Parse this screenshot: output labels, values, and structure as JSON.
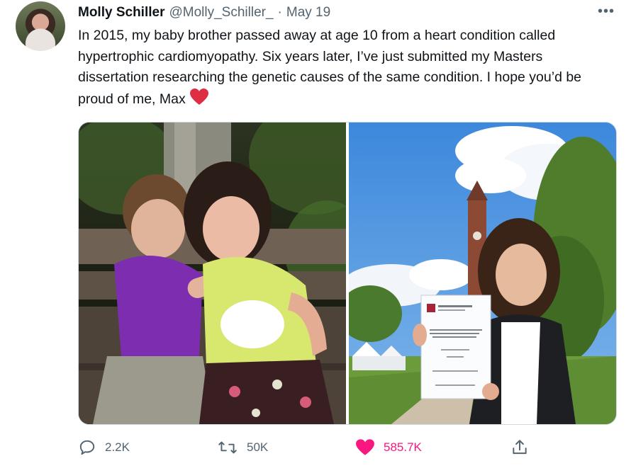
{
  "author": {
    "display_name": "Molly Schiller",
    "handle": "@Molly_Schiller_",
    "separator": "·",
    "date": "May 19"
  },
  "tweet": {
    "text": "In 2015, my baby brother passed away at age 10 from a heart condition called hypertrophic cardiomyopathy. Six years later, I’ve just submitted my Masters dissertation researching the genetic causes of the same condition. I hope you’d be proud of me, Max",
    "emoji": "red-heart"
  },
  "media": [
    {
      "name": "photo-childhood-hug",
      "description_icon": "photo"
    },
    {
      "name": "photo-dissertation-clocktower",
      "description_icon": "photo"
    }
  ],
  "actions": {
    "reply_count": "2.2K",
    "retweet_count": "50K",
    "like_count": "585.7K",
    "share_icon": "share-icon"
  },
  "colors": {
    "like_pink": "#f91880",
    "muted_gray": "#536471",
    "text": "#0f1419"
  }
}
